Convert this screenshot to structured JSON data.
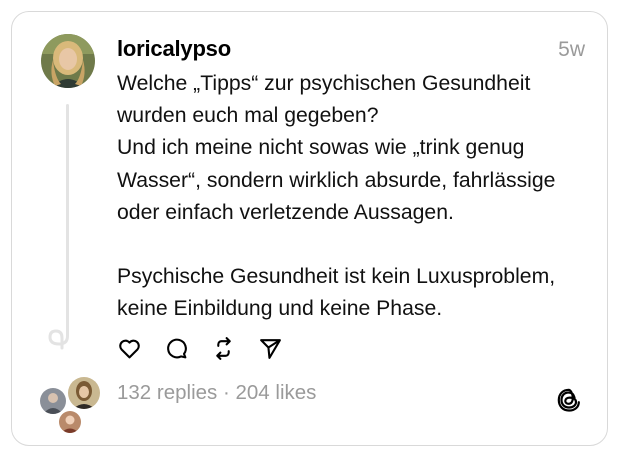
{
  "post": {
    "username": "loricalypso",
    "time": "5w",
    "text_lines": [
      "Welche „Tipps“ zur psychischen Gesundheit",
      "wurden euch mal gegeben?",
      "Und ich meine nicht sowas wie „trink genug",
      "Wasser“, sondern wirklich absurde, fahrlässige",
      "oder einfach verletzende Aussagen.",
      "",
      "Psychische Gesundheit ist kein Luxusproblem,",
      "keine Einbildung und keine Phase."
    ]
  },
  "actions": {
    "like_icon": "heart-icon",
    "reply_icon": "comment-bubble-icon",
    "repost_icon": "repost-icon",
    "share_icon": "send-icon"
  },
  "stats": {
    "text": "132 replies · 204 likes"
  },
  "brand": {
    "logo_icon": "threads-logo-icon"
  },
  "colors": {
    "muted_text": "#9a9a9a",
    "border": "#d9d9d9",
    "thread_line": "#e3e3e3"
  }
}
